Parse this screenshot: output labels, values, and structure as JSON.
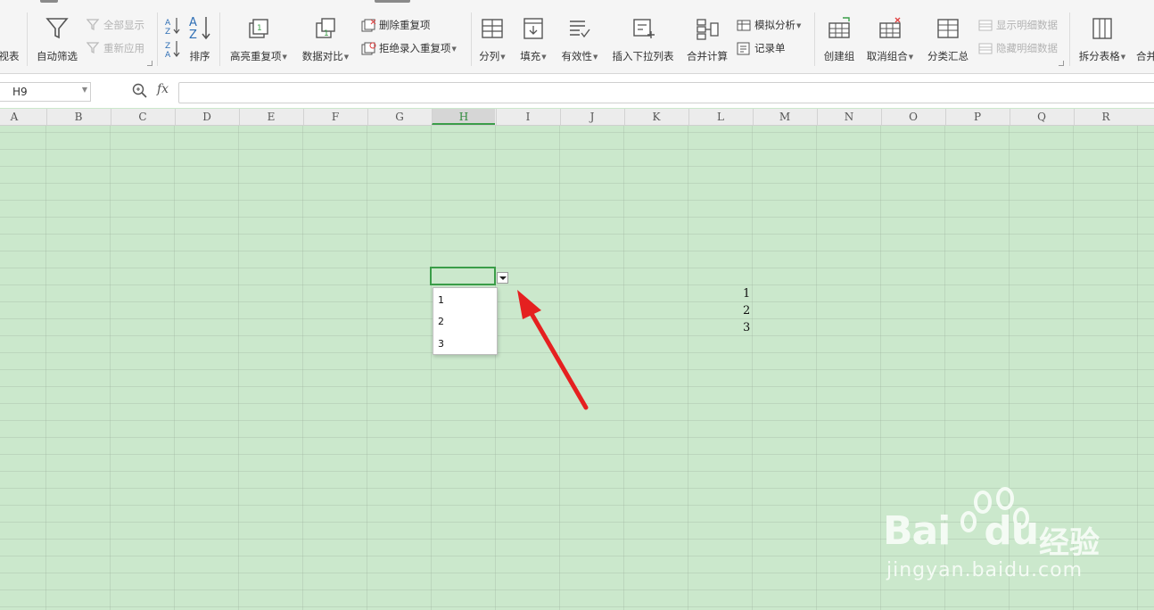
{
  "ribbon": {
    "partial_left": "视表",
    "auto_filter": "自动筛选",
    "show_all": "全部显示",
    "reapply": "重新应用",
    "sort": "排序",
    "highlight_dup": "高亮重复项",
    "data_compare": "数据对比",
    "delete_dup": "删除重复项",
    "reject_dup": "拒绝录入重复项",
    "split": "分列",
    "fill": "填充",
    "validity": "有效性",
    "insert_dropdown": "插入下拉列表",
    "consolidate": "合并计算",
    "whatif": "模拟分析",
    "record": "记录单",
    "create_group": "创建组",
    "ungroup": "取消组合",
    "subtotal": "分类汇总",
    "show_detail": "显示明细数据",
    "hide_detail": "隐藏明细数据",
    "split_table": "拆分表格",
    "partial_right": "合并"
  },
  "formula_bar": {
    "name_box": "H9",
    "fx_label": "fx",
    "formula": ""
  },
  "columns": [
    "A",
    "B",
    "C",
    "D",
    "E",
    "F",
    "G",
    "H",
    "I",
    "J",
    "K",
    "L",
    "M",
    "N",
    "O",
    "P",
    "Q",
    "R"
  ],
  "selected_column": "H",
  "dropdown_options": [
    "1",
    "2",
    "3"
  ],
  "cells": {
    "L10": "1",
    "L11": "2",
    "L12": "3"
  },
  "watermark": {
    "brand": "Bai",
    "brand2": "du",
    "cn": "经验",
    "url": "jingyan.baidu.com"
  },
  "colors": {
    "accent": "#3a9d48",
    "sheet_bg": "#cbe8cc",
    "arrow": "#e52020"
  }
}
